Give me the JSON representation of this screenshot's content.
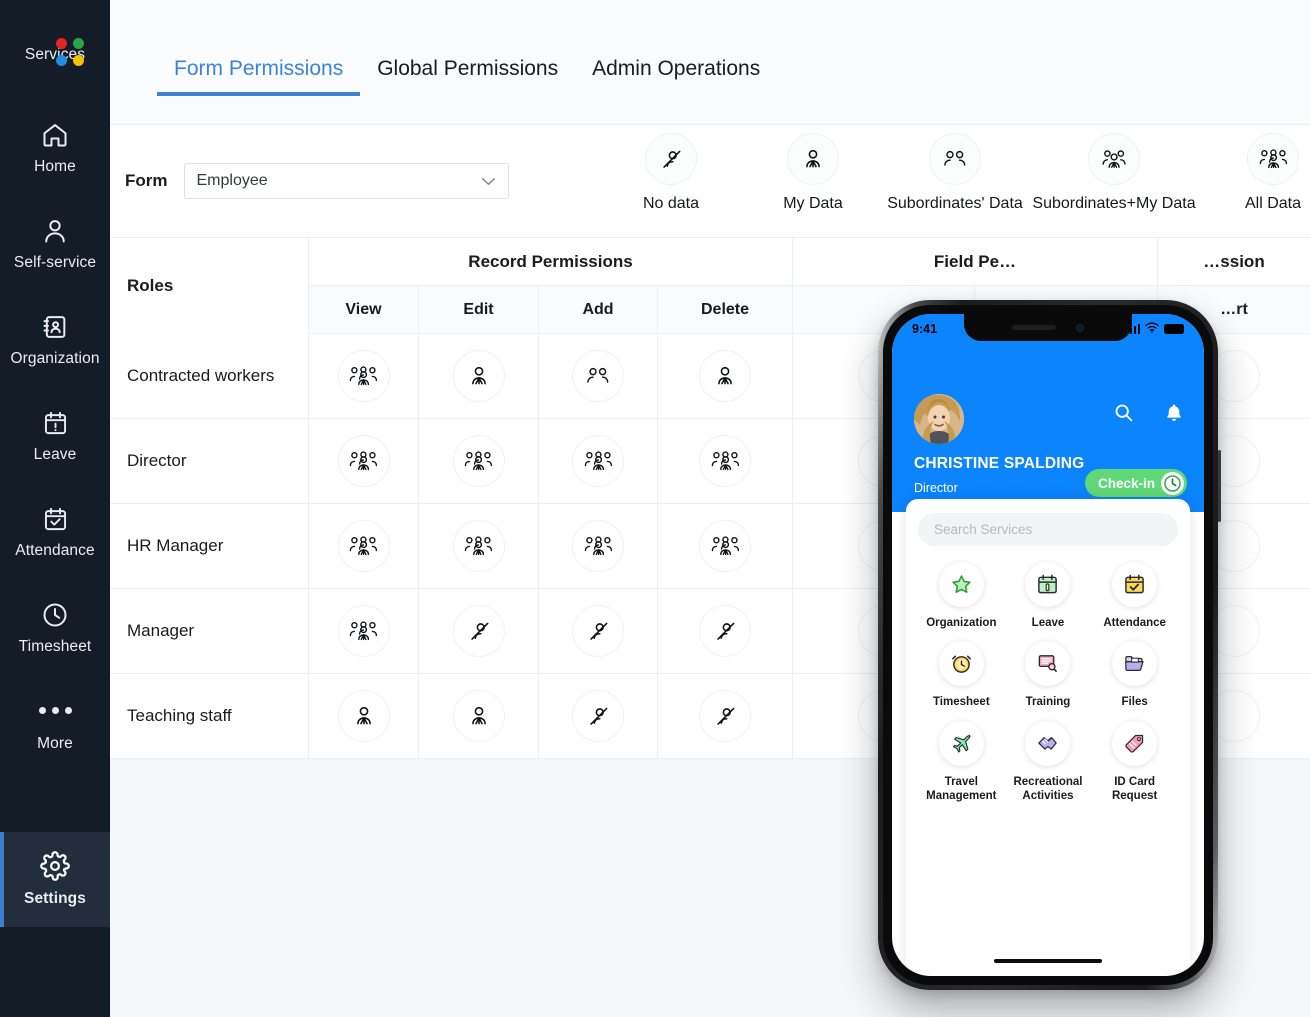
{
  "sidebar": {
    "items": [
      {
        "label": "Services",
        "icon": "zoho-logo-icon",
        "active": false
      },
      {
        "label": "Home",
        "icon": "home-icon",
        "active": false
      },
      {
        "label": "Self-service",
        "icon": "user-icon",
        "active": false
      },
      {
        "label": "Organization",
        "icon": "organization-book-icon",
        "active": false
      },
      {
        "label": "Leave",
        "icon": "calendar-alert-icon",
        "active": false
      },
      {
        "label": "Attendance",
        "icon": "calendar-check-icon",
        "active": false
      },
      {
        "label": "Timesheet",
        "icon": "clock-icon",
        "active": false
      },
      {
        "label": "More",
        "icon": "ellipsis-icon",
        "active": false
      },
      {
        "label": "Settings",
        "icon": "gear-icon",
        "active": true
      }
    ]
  },
  "tabs": [
    {
      "label": "Form Permissions",
      "active": true
    },
    {
      "label": "Global Permissions",
      "active": false
    },
    {
      "label": "Admin Operations",
      "active": false
    }
  ],
  "toolbar": {
    "form_label": "Form",
    "form_value": "Employee",
    "form_chevron": "chevron-down-icon"
  },
  "legend": [
    {
      "label": "No data",
      "icon": "no-data-icon"
    },
    {
      "label": "My Data",
      "icon": "one-person-icon"
    },
    {
      "label": "Subordinates' Data",
      "icon": "two-people-icon"
    },
    {
      "label": "Subordinates+My Data",
      "icon": "three-people-icon"
    },
    {
      "label": "All Data",
      "icon": "four-people-icon"
    }
  ],
  "table": {
    "roles_header": "Roles",
    "groups": [
      {
        "label": "Record Permissions"
      },
      {
        "label": "Field Pe…"
      },
      {
        "label": "…ssion"
      }
    ],
    "columns": [
      "View",
      "Edit",
      "Add",
      "Delete",
      "",
      "",
      "…rt"
    ],
    "rows": [
      {
        "role": "Contracted workers",
        "perms": [
          "four",
          "one",
          "two",
          "one",
          "",
          "",
          ""
        ]
      },
      {
        "role": "Director",
        "perms": [
          "four",
          "four",
          "four",
          "four",
          "",
          "",
          ""
        ]
      },
      {
        "role": "HR Manager",
        "perms": [
          "four",
          "four",
          "four",
          "four",
          "",
          "",
          ""
        ]
      },
      {
        "role": "Manager",
        "perms": [
          "four",
          "none",
          "none",
          "none",
          "",
          "",
          ""
        ]
      },
      {
        "role": "Teaching staff",
        "perms": [
          "one",
          "one",
          "none",
          "none",
          "",
          "",
          ""
        ]
      }
    ]
  },
  "phone": {
    "status": {
      "time": "9:41",
      "signal": "cellular-bars-icon",
      "wifi": "wifi-icon",
      "battery": "battery-icon"
    },
    "header": {
      "avatar": "user-avatar",
      "search_icon": "search-icon",
      "bell_icon": "bell-icon",
      "name": "CHRISTINE SPALDING",
      "role": "Director",
      "checkin_label": "Check-in",
      "checkin_icon": "clock-icon"
    },
    "search_placeholder": "Search Services",
    "services": [
      {
        "label": "Organization",
        "icon": "star-icon"
      },
      {
        "label": "Leave",
        "icon": "calendar-leave-icon"
      },
      {
        "label": "Attendance",
        "icon": "calendar-check-icon"
      },
      {
        "label": "Timesheet",
        "icon": "alarm-clock-icon"
      },
      {
        "label": "Training",
        "icon": "training-board-icon"
      },
      {
        "label": "Files",
        "icon": "folder-icon"
      },
      {
        "label": "Travel\nManagement",
        "icon": "airplane-icon"
      },
      {
        "label": "Recreational\nActivities",
        "icon": "handshake-icon"
      },
      {
        "label": "ID Card\nRequest",
        "icon": "tag-icon"
      }
    ]
  },
  "colors": {
    "accent_blue": "#3e84d6",
    "sidebar_bg": "#131c27",
    "phone_blue": "#0b84fe",
    "checkin_green": "#60d877"
  }
}
